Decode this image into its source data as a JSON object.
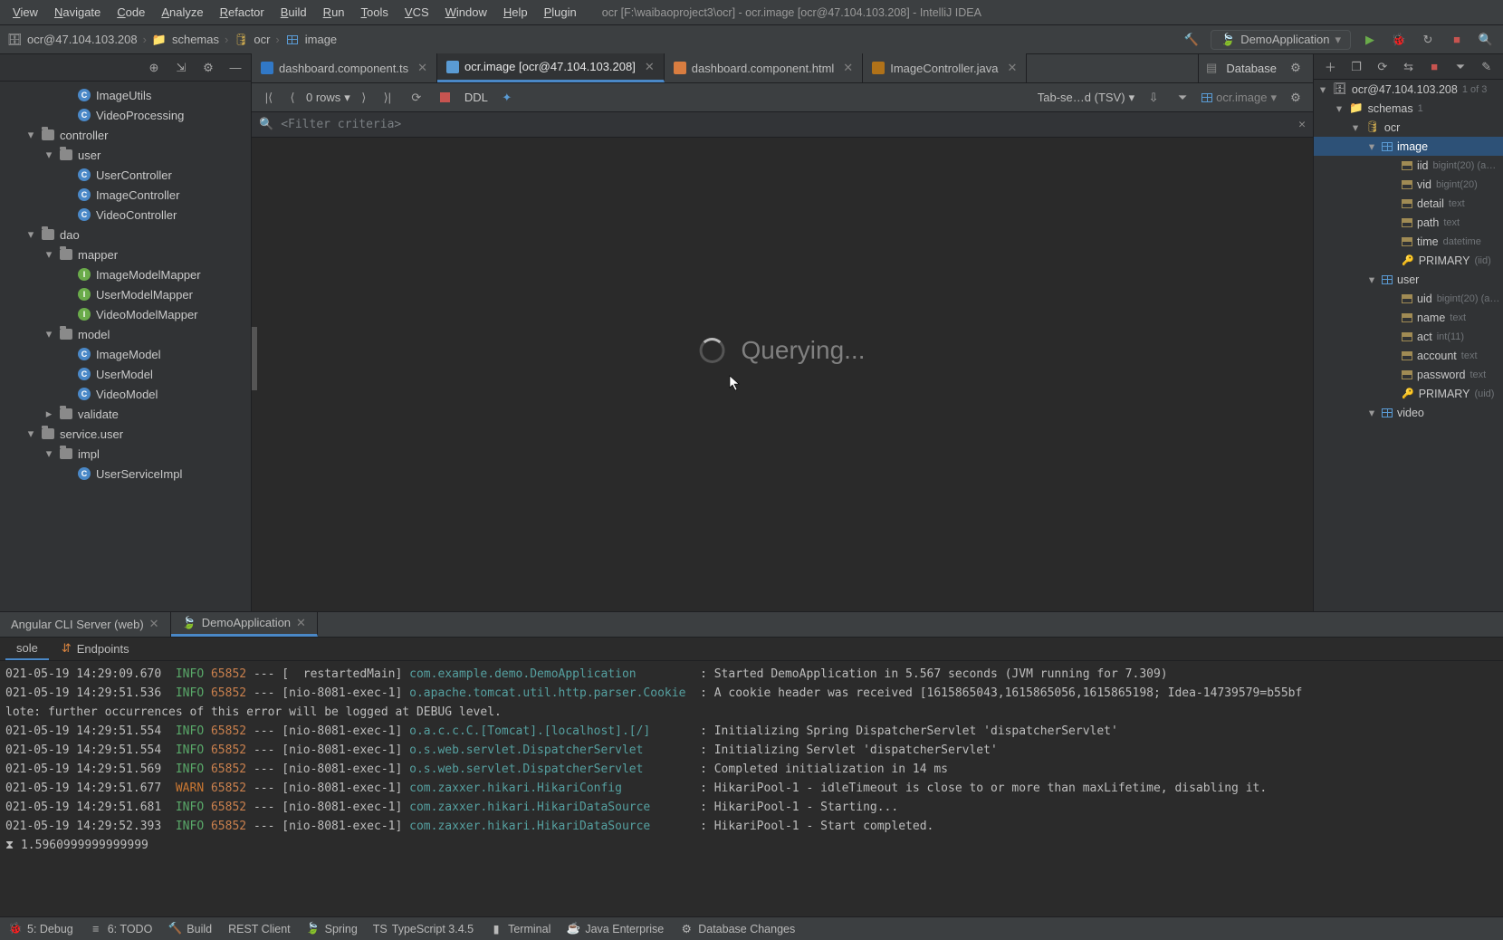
{
  "window": {
    "title": "ocr [F:\\waibaoproject3\\ocr] - ocr.image [ocr@47.104.103.208] - IntelliJ IDEA"
  },
  "menu": [
    "View",
    "Navigate",
    "Code",
    "Analyze",
    "Refactor",
    "Build",
    "Run",
    "Tools",
    "VCS",
    "Window",
    "Help",
    "Plugin"
  ],
  "breadcrumb": {
    "host": "ocr@47.104.103.208",
    "schema": "schemas",
    "db": "ocr",
    "table": "image"
  },
  "runconfig": {
    "label": "DemoApplication"
  },
  "project": {
    "nodes": [
      {
        "lvl": 3,
        "kind": "class",
        "cls": "c",
        "label": "ImageUtils"
      },
      {
        "lvl": 3,
        "kind": "class",
        "cls": "c",
        "label": "VideoProcessing"
      },
      {
        "lvl": 1,
        "kind": "pkg",
        "tw": "▾",
        "label": "controller"
      },
      {
        "lvl": 2,
        "kind": "pkg",
        "tw": "▾",
        "label": "user"
      },
      {
        "lvl": 3,
        "kind": "class",
        "cls": "c",
        "label": "UserController"
      },
      {
        "lvl": 3,
        "kind": "class",
        "cls": "c",
        "label": "ImageController"
      },
      {
        "lvl": 3,
        "kind": "class",
        "cls": "c",
        "label": "VideoController"
      },
      {
        "lvl": 1,
        "kind": "pkg",
        "tw": "▾",
        "label": "dao"
      },
      {
        "lvl": 2,
        "kind": "pkg",
        "tw": "▾",
        "label": "mapper"
      },
      {
        "lvl": 3,
        "kind": "class",
        "cls": "i",
        "label": "ImageModelMapper"
      },
      {
        "lvl": 3,
        "kind": "class",
        "cls": "i",
        "label": "UserModelMapper"
      },
      {
        "lvl": 3,
        "kind": "class",
        "cls": "i",
        "label": "VideoModelMapper"
      },
      {
        "lvl": 2,
        "kind": "pkg",
        "tw": "▾",
        "label": "model"
      },
      {
        "lvl": 3,
        "kind": "class",
        "cls": "c",
        "label": "ImageModel"
      },
      {
        "lvl": 3,
        "kind": "class",
        "cls": "c",
        "label": "UserModel"
      },
      {
        "lvl": 3,
        "kind": "class",
        "cls": "c",
        "label": "VideoModel"
      },
      {
        "lvl": 2,
        "kind": "pkg",
        "tw": "▸",
        "label": "validate"
      },
      {
        "lvl": 1,
        "kind": "pkg",
        "tw": "▾",
        "label": "service.user"
      },
      {
        "lvl": 2,
        "kind": "pkg",
        "tw": "▾",
        "label": "impl"
      },
      {
        "lvl": 3,
        "kind": "class",
        "cls": "c",
        "label": "UserServiceImpl"
      }
    ]
  },
  "tabs": [
    {
      "label": "dashboard.component.ts",
      "kind": "ts",
      "active": false
    },
    {
      "label": "ocr.image [ocr@47.104.103.208]",
      "kind": "db",
      "active": true
    },
    {
      "label": "dashboard.component.html",
      "kind": "html",
      "active": false
    },
    {
      "label": "ImageController.java",
      "kind": "java",
      "active": false
    }
  ],
  "grid": {
    "rows_label": "0 rows",
    "ddl": "DDL",
    "view_mode": "Tab-se…d (TSV)",
    "ds_label": "ocr.image",
    "filter_placeholder": "<Filter criteria>",
    "querying": "Querying..."
  },
  "database": {
    "title": "Database",
    "root": "ocr@47.104.103.208",
    "root_note": "1 of 3",
    "schema_label": "schemas",
    "schema_count": "1",
    "db": "ocr",
    "tables": [
      {
        "name": "image",
        "selected": true,
        "cols": [
          {
            "n": "iid",
            "t": "bigint(20) (a…"
          },
          {
            "n": "vid",
            "t": "bigint(20)"
          },
          {
            "n": "detail",
            "t": "text"
          },
          {
            "n": "path",
            "t": "text"
          },
          {
            "n": "time",
            "t": "datetime"
          }
        ],
        "key": "PRIMARY",
        "key_t": "(iid)"
      },
      {
        "name": "user",
        "selected": false,
        "cols": [
          {
            "n": "uid",
            "t": "bigint(20) (a…"
          },
          {
            "n": "name",
            "t": "text"
          },
          {
            "n": "act",
            "t": "int(11)"
          },
          {
            "n": "account",
            "t": "text"
          },
          {
            "n": "password",
            "t": "text"
          }
        ],
        "key": "PRIMARY",
        "key_t": "(uid)"
      },
      {
        "name": "video",
        "selected": false,
        "cols": []
      }
    ]
  },
  "run": {
    "tabs": [
      {
        "label": "Angular CLI Server (web)",
        "active": false
      },
      {
        "label": "DemoApplication",
        "active": true
      }
    ],
    "subtabs": [
      {
        "label": "sole",
        "active": true
      },
      {
        "label": "Endpoints",
        "active": false
      }
    ],
    "timing": "1.5960999999999999",
    "lines": [
      {
        "ts": "021-05-19 14:29:09.670",
        "lvl": "INFO",
        "pid": "65852",
        "thr": "[  restartedMain]",
        "cls": "com.example.demo.DemoApplication",
        "msg": ": Started DemoApplication in 5.567 seconds (JVM running for 7.309)"
      },
      {
        "ts": "021-05-19 14:29:51.536",
        "lvl": "INFO",
        "pid": "65852",
        "thr": "[nio-8081-exec-1]",
        "cls": "o.apache.tomcat.util.http.parser.Cookie",
        "msg": ": A cookie header was received [1615865043,1615865056,1615865198; Idea-14739579=b55bf"
      },
      {
        "note": "lote: further occurrences of this error will be logged at DEBUG level."
      },
      {
        "ts": "021-05-19 14:29:51.554",
        "lvl": "INFO",
        "pid": "65852",
        "thr": "[nio-8081-exec-1]",
        "cls": "o.a.c.c.C.[Tomcat].[localhost].[/]",
        "msg": ": Initializing Spring DispatcherServlet 'dispatcherServlet'"
      },
      {
        "ts": "021-05-19 14:29:51.554",
        "lvl": "INFO",
        "pid": "65852",
        "thr": "[nio-8081-exec-1]",
        "cls": "o.s.web.servlet.DispatcherServlet",
        "msg": ": Initializing Servlet 'dispatcherServlet'"
      },
      {
        "ts": "021-05-19 14:29:51.569",
        "lvl": "INFO",
        "pid": "65852",
        "thr": "[nio-8081-exec-1]",
        "cls": "o.s.web.servlet.DispatcherServlet",
        "msg": ": Completed initialization in 14 ms"
      },
      {
        "ts": "021-05-19 14:29:51.677",
        "lvl": "WARN",
        "pid": "65852",
        "thr": "[nio-8081-exec-1]",
        "cls": "com.zaxxer.hikari.HikariConfig",
        "msg": ": HikariPool-1 - idleTimeout is close to or more than maxLifetime, disabling it."
      },
      {
        "ts": "021-05-19 14:29:51.681",
        "lvl": "INFO",
        "pid": "65852",
        "thr": "[nio-8081-exec-1]",
        "cls": "com.zaxxer.hikari.HikariDataSource",
        "msg": ": HikariPool-1 - Starting..."
      },
      {
        "ts": "021-05-19 14:29:52.393",
        "lvl": "INFO",
        "pid": "65852",
        "thr": "[nio-8081-exec-1]",
        "cls": "com.zaxxer.hikari.HikariDataSource",
        "msg": ": HikariPool-1 - Start completed."
      }
    ]
  },
  "status": [
    {
      "icon": "🐞",
      "label": "5: Debug"
    },
    {
      "icon": "≡",
      "label": "6: TODO"
    },
    {
      "icon": "🔨",
      "label": "Build"
    },
    {
      "icon": "",
      "label": "REST Client"
    },
    {
      "icon": "🍃",
      "label": "Spring"
    },
    {
      "icon": "TS",
      "label": "TypeScript 3.4.5"
    },
    {
      "icon": "▮",
      "label": "Terminal"
    },
    {
      "icon": "☕",
      "label": "Java Enterprise"
    },
    {
      "icon": "⚙",
      "label": "Database Changes"
    }
  ]
}
